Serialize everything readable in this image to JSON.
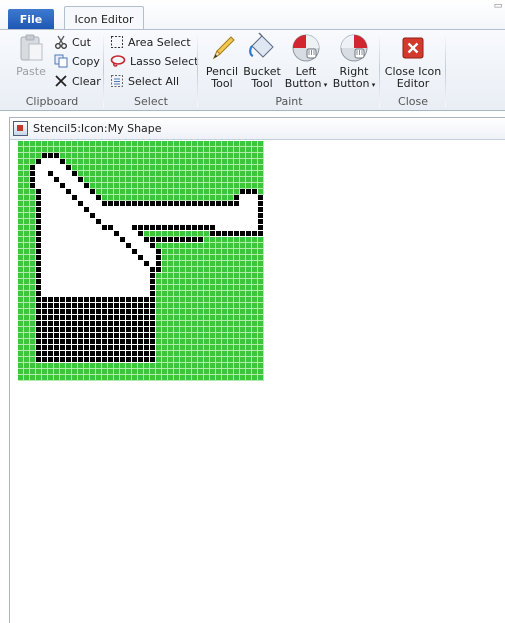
{
  "tabs": {
    "file": "File",
    "active": "Icon Editor"
  },
  "ribbon": {
    "clipboard": {
      "label": "Clipboard",
      "paste": "Paste",
      "cut": "Cut",
      "copy": "Copy",
      "clear": "Clear"
    },
    "select": {
      "label": "Select",
      "area": "Area Select",
      "lasso": "Lasso Select",
      "all": "Select All"
    },
    "paint": {
      "label": "Paint",
      "pencil_1": "Pencil",
      "pencil_2": "Tool",
      "bucket_1": "Bucket",
      "bucket_2": "Tool",
      "left_1": "Left",
      "left_2": "Button",
      "right_1": "Right",
      "right_2": "Button"
    },
    "close": {
      "label": "Close",
      "btn_1": "Close Icon",
      "btn_2": "Editor"
    }
  },
  "document": {
    "title": "Stencil5:Icon:My Shape",
    "icon_grid": {
      "columns": 41,
      "rows": 40,
      "colors": {
        "G": "#3bc63b",
        "W": "#ffffff",
        "B": "#000000"
      },
      "pixels": [
        "GGGGGGGGGGGGGGGGGGGGGGGGGGGGGGGGGGGGGGGGG",
        "GGGGGGGGGGGGGGGGGGGGGGGGGGGGGGGGGGGGGGGGG",
        "GGGGBBBGGGGGGGGGGGGGGGGGGGGGGGGGGGGGGGGGG",
        "GGGBWWWBGGGGGGGGGGGGGGGGGGGGGGGGGGGGGGGGG",
        "GGBWWWWWBGGGGGGGGGGGGGGGGGGGGGGGGGGGGGGGG",
        "GGBWWBWWWBGGGGGGGGGGGGGGGGGGGGGGGGGGGGGGG",
        "GGBWWWBWWWBGGGGGGGGGGGGGGGGGGGGGGGGGGGGGG",
        "GGBWWWWBWWWBGGGGGGGGGGGGGGGGGGGGGGGGGGGGG",
        "GGGBWWWWBWWWBGGGGGGGGGGGGGGGGGGGGGGGGBBBG",
        "GGGBWWWWWBWWWBGGGGGGGGGGGGGGGGGGGGGGBWWWB",
        "GGGBWWWWWWBWWWBBBBBBBBBBBBBBBBBBBBBBBWWWB",
        "GGGBWWWWWWWBWWWWWWWWWWWWWWWWWWWWWWWWWWWWB",
        "GGGBWWWWWWWWBWWWWWWWWWWWWWWWWWWWWWWWWWWWB",
        "GGGBWWWWWWWWWBWWWWWWWWWWWWWWWWWWWWWWWWWWB",
        "GGGBWWWWWWWWWWBBWWWBBBBBBBBBBBBBBWWWWWWWB",
        "GGGBWWWWWWWWWWWWBWWWBGGGGGGGGGGGBBBBBBBBB",
        "GGGBWWWWWWWWWWWWWBWWWBBBBBBBBBBGGGGGGGGGG",
        "GGGBWWWWWWWWWWWWWWBWWWBGGGGGGGGGGGGGGGGGG",
        "GGGBWWWWWWWWWWWWWWWBWWWBGGGGGGGGGGGGGGGGG",
        "GGGBWWWWWWWWWWWWWWWWBWWBGGGGGGGGGGGGGGGGG",
        "GGGBWWWWWWWWWWWWWWWWWBWBGGGGGGGGGGGGGGGGG",
        "GGGBWWWWWWWWWWWWWWWWWWBBGGGGGGGGGGGGGGGGG",
        "GGGBWWWWWWWWWWWWWWWWWWBGGGGGGGGGGGGGGGGGG",
        "GGGBWWWWWWWWWWWWWWWWWWBGGGGGGGGGGGGGGGGGG",
        "GGGBWWWWWWWWWWWWWWWWWWBGGGGGGGGGGGGGGGGGG",
        "GGGBWWWWWWWWWWWWWWWWWWBGGGGGGGGGGGGGGGGGG",
        "GGGBBBBBBBBBBBBBBBBBBBBGGGGGGGGGGGGGGGGGG",
        "GGGBBBBBBBBBBBBBBBBBBBBGGGGGGGGGGGGGGGGGG",
        "GGGBBBBBBBBBBBBBBBBBBBBGGGGGGGGGGGGGGGGGG",
        "GGGBBBBBBBBBBBBBBBBBBBBGGGGGGGGGGGGGGGGGG",
        "GGGBBBBBBBBBBBBBBBBBBBBGGGGGGGGGGGGGGGGGG",
        "GGGBBBBBBBBBBBBBBBBBBBBGGGGGGGGGGGGGGGGGG",
        "GGGBBBBBBBBBBBBBBBBBBBBGGGGGGGGGGGGGGGGGG",
        "GGGBBBBBBBBBBBBBBBBBBBBGGGGGGGGGGGGGGGGGG",
        "GGGBBBBBBBBBBBBBBBBBBBBGGGGGGGGGGGGGGGGGG",
        "GGGBBBBBBBBBBBBBBBBBBBBGGGGGGGGGGGGGGGGGG",
        "GGGBBBBBBBBBBBBBBBBBBBBGGGGGGGGGGGGGGGGGG",
        "GGGGGGGGGGGGGGGGGGGGGGGGGGGGGGGGGGGGGGGGG",
        "GGGGGGGGGGGGGGGGGGGGGGGGGGGGGGGGGGGGGGGGG",
        "GGGGGGGGGGGGGGGGGGGGGGGGGGGGGGGGGGGGGGGGG"
      ]
    }
  },
  "icons": {
    "paste": "clipboard-icon",
    "cut": "scissors-icon",
    "copy": "copy-icon",
    "clear": "x-icon",
    "area": "dashed-rect-icon",
    "lasso": "lasso-icon",
    "all": "select-all-icon",
    "pencil": "pencil-icon",
    "bucket": "bucket-icon",
    "left": "left-mouse-icon",
    "right": "right-mouse-icon",
    "close": "close-red-icon"
  }
}
